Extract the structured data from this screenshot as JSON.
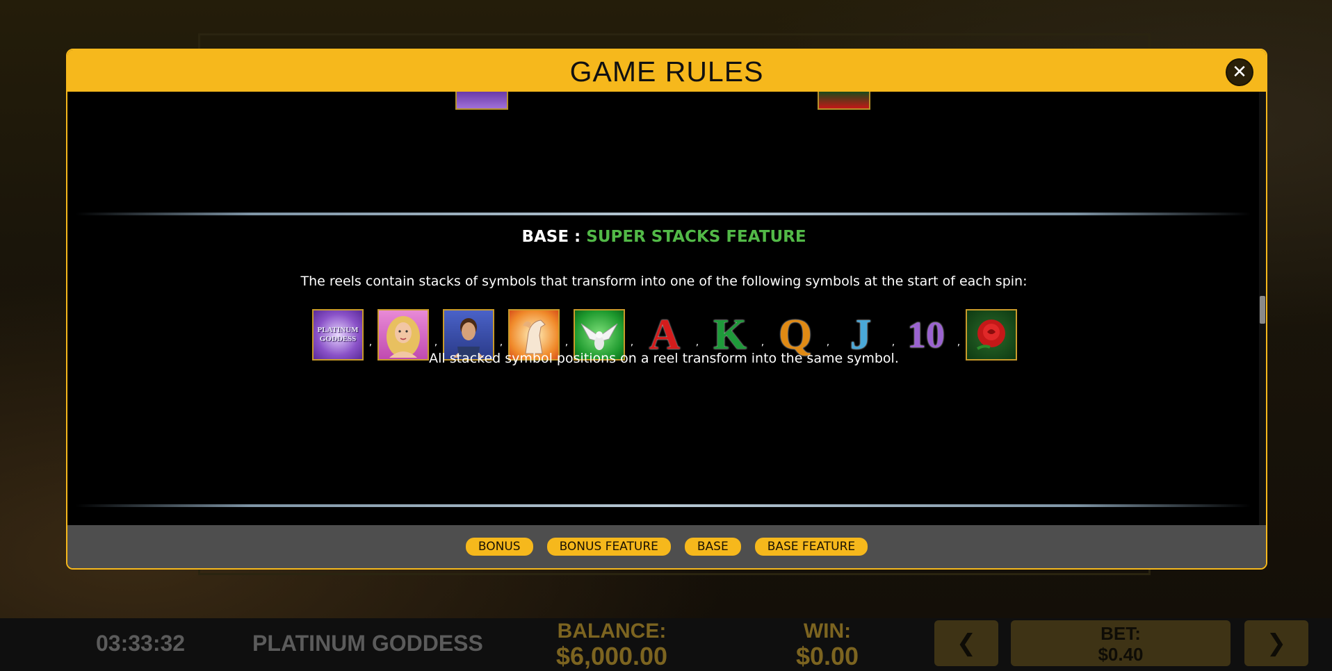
{
  "modal": {
    "title": "GAME RULES",
    "close_icon": "close-icon"
  },
  "section": {
    "title_prefix": "BASE : ",
    "title_accent": "SUPER STACKS FEATURE",
    "description": "The reels contain stacks of symbols that transform into one of the following symbols at the start of each spin:",
    "note": "All stacked symbol positions on a reel transform into the same symbol.",
    "separator": ",",
    "symbols": [
      "platinum-goddess-logo",
      "goddess",
      "warrior",
      "pegasus",
      "dove",
      "A",
      "K",
      "Q",
      "J",
      "10",
      "rose"
    ],
    "logo_text": [
      "PLATINUM",
      "GODDESS"
    ]
  },
  "footer": {
    "buttons": [
      "BONUS",
      "BONUS FEATURE",
      "BASE",
      "BASE FEATURE"
    ]
  },
  "bottom_bar": {
    "clock": "03:33:32",
    "game_name": "PLATINUM GODDESS",
    "balance_label": "BALANCE:",
    "balance_value": "$6,000.00",
    "win_label": "WIN:",
    "win_value": "$0.00",
    "bet_label": "BET:",
    "bet_value": "$0.40",
    "prev_icon": "chevron-left-icon",
    "next_icon": "chevron-right-icon"
  },
  "colors": {
    "accent": "#f6b81c",
    "feature_green": "#52b947"
  }
}
